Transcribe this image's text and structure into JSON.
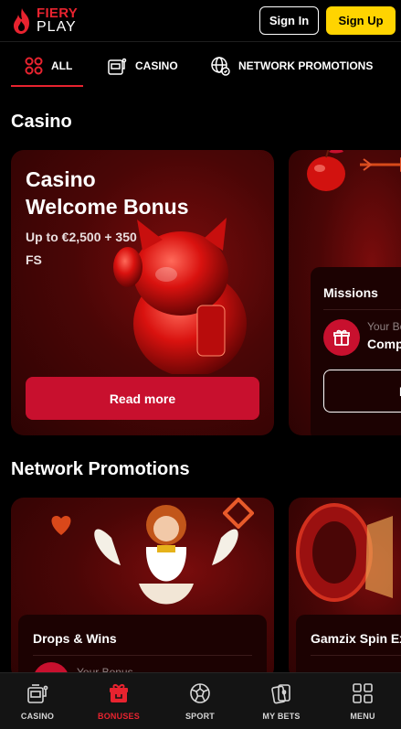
{
  "header": {
    "logo_line1": "FIERY",
    "logo_line2": "PLAY",
    "signin_label": "Sign In",
    "signup_label": "Sign Up"
  },
  "tabs": [
    {
      "label": "ALL",
      "icon": "grid-icon",
      "active": true
    },
    {
      "label": "CASINO",
      "icon": "slot-machine-icon",
      "active": false
    },
    {
      "label": "NETWORK PROMOTIONS",
      "icon": "globe-icon",
      "active": false
    }
  ],
  "casino_section": {
    "title": "Casino",
    "welcome_card": {
      "title_line1": "Casino",
      "title_line2": "Welcome Bonus",
      "subtitle_line1": "Up to €2,500 + 350",
      "subtitle_line2": "FS",
      "button_label": "Read more"
    },
    "missions_card": {
      "title": "Missions",
      "your_label": "Your Bon",
      "status": "Comple",
      "button_label": "Re"
    }
  },
  "network_section": {
    "title": "Network Promotions",
    "cards": [
      {
        "title": "Drops & Wins",
        "your_label": "Your Bonus"
      },
      {
        "title": "Gamzix Spin Ex",
        "your_label": ""
      }
    ]
  },
  "bottom_nav": [
    {
      "label": "CASINO",
      "icon": "slot-machine-icon",
      "active": false
    },
    {
      "label": "BONUSES",
      "icon": "gift-icon",
      "active": true
    },
    {
      "label": "SPORT",
      "icon": "soccer-ball-icon",
      "active": false
    },
    {
      "label": "MY BETS",
      "icon": "cards-icon",
      "active": false
    },
    {
      "label": "MENU",
      "icon": "menu-grid-icon",
      "active": false
    }
  ],
  "colors": {
    "brand_red": "#e8232f",
    "signup_yellow": "#ffd400",
    "button_red": "#c8102e"
  }
}
